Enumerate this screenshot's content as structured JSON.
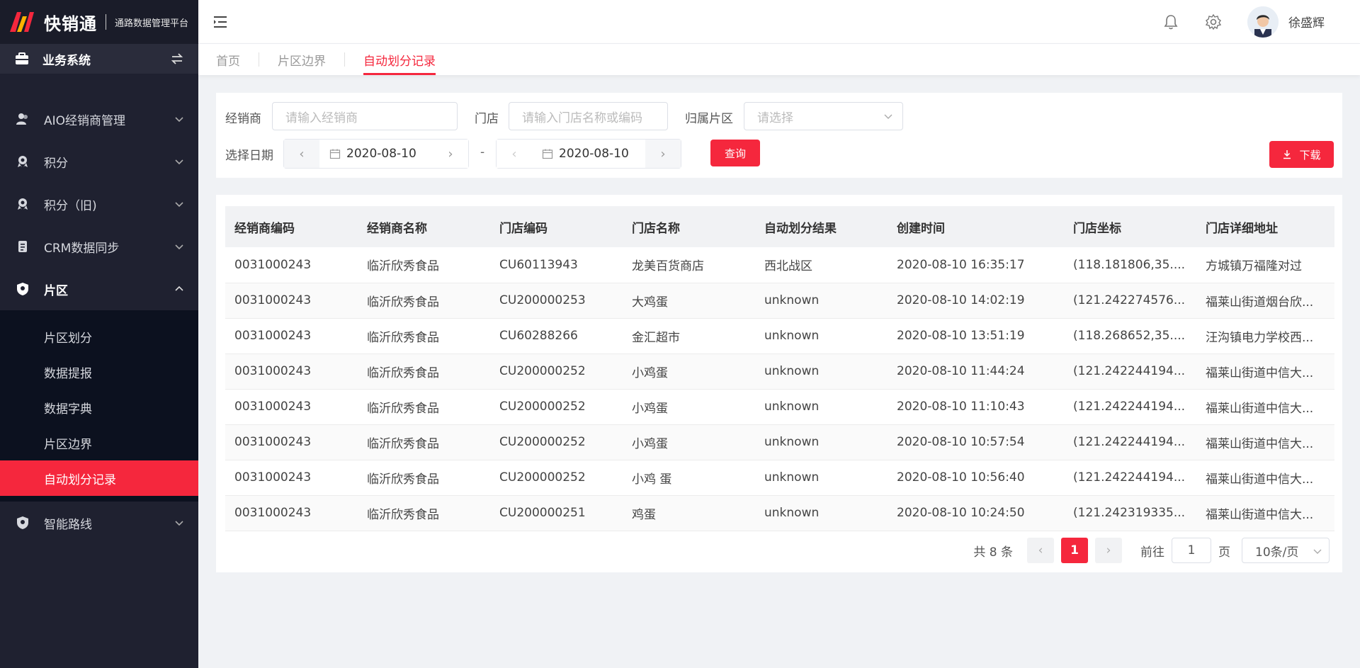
{
  "app": {
    "title": "快销通",
    "subtitle": "通路数据管理平台",
    "brand_color": "#f5273d"
  },
  "sidebar": {
    "system": {
      "label": "业务系统",
      "icon": "briefcase-icon"
    },
    "items": [
      {
        "label": "AIO经销商管理",
        "icon": "user-group-icon"
      },
      {
        "label": "积分",
        "icon": "medal-icon"
      },
      {
        "label": "积分（旧)",
        "icon": "medal-icon"
      },
      {
        "label": "CRM数据同步",
        "icon": "document-icon"
      },
      {
        "label": "片区",
        "icon": "shield-icon"
      },
      {
        "label": "智能路线",
        "icon": "shield-icon"
      }
    ],
    "subitems": [
      {
        "label": "片区划分"
      },
      {
        "label": "数据提报"
      },
      {
        "label": "数据字典"
      },
      {
        "label": "片区边界"
      },
      {
        "label": "自动划分记录"
      }
    ]
  },
  "header": {
    "username": "徐盛辉"
  },
  "tabs": [
    {
      "label": "首页"
    },
    {
      "label": "片区边界"
    },
    {
      "label": "自动划分记录"
    }
  ],
  "filter": {
    "dealer_label": "经销商",
    "dealer_placeholder": "请输入经销商",
    "store_label": "门店",
    "store_placeholder": "请输入门店名称或编码",
    "area_label": "归属片区",
    "area_placeholder": "请选择",
    "date_label": "选择日期",
    "start_date": "2020-08-10",
    "end_date": "2020-08-10",
    "dash": "-",
    "query_button": "查询",
    "download_button": "下载"
  },
  "table": {
    "columns": [
      "经销商编码",
      "经销商名称",
      "门店编码",
      "门店名称",
      "自动划分结果",
      "创建时间",
      "门店坐标",
      "门店详细地址"
    ],
    "rows": [
      [
        "0031000243",
        "临沂欣秀食品",
        "CU60113943",
        "龙美百货商店",
        "西北战区",
        "2020-08-10 16:35:17",
        "(118.181806,35....",
        "方城镇万福隆对过"
      ],
      [
        "0031000243",
        "临沂欣秀食品",
        "CU200000253",
        "大鸡蛋",
        "unknown",
        "2020-08-10 14:02:19",
        "(121.242274576...",
        "福莱山街道烟台欣..."
      ],
      [
        "0031000243",
        "临沂欣秀食品",
        "CU60288266",
        "金汇超市",
        "unknown",
        "2020-08-10 13:51:19",
        "(118.268652,35....",
        "汪沟镇电力学校西..."
      ],
      [
        "0031000243",
        "临沂欣秀食品",
        "CU200000252",
        "小鸡蛋",
        "unknown",
        "2020-08-10 11:44:24",
        "(121.242244194...",
        "福莱山街道中信大..."
      ],
      [
        "0031000243",
        "临沂欣秀食品",
        "CU200000252",
        "小鸡蛋",
        "unknown",
        "2020-08-10 11:10:43",
        "(121.242244194...",
        "福莱山街道中信大..."
      ],
      [
        "0031000243",
        "临沂欣秀食品",
        "CU200000252",
        "小鸡蛋",
        "unknown",
        "2020-08-10 10:57:54",
        "(121.242244194...",
        "福莱山街道中信大..."
      ],
      [
        "0031000243",
        "临沂欣秀食品",
        "CU200000252",
        "小鸡 蛋",
        "unknown",
        "2020-08-10 10:56:40",
        "(121.242244194...",
        "福莱山街道中信大..."
      ],
      [
        "0031000243",
        "临沂欣秀食品",
        "CU200000251",
        "鸡蛋",
        "unknown",
        "2020-08-10 10:24:50",
        "(121.242319335...",
        "福莱山街道中信大..."
      ]
    ]
  },
  "pagination": {
    "total": "共 8 条",
    "current_page": "1",
    "goto_label": "前往",
    "goto_value": "1",
    "page_unit": "页",
    "page_size": "10条/页"
  }
}
